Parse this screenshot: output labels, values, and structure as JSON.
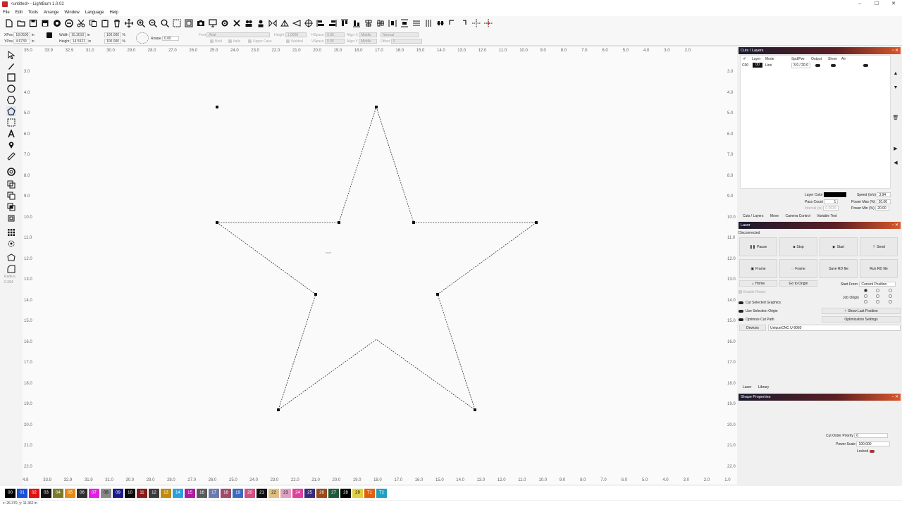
{
  "window": {
    "title": "<untitled> - LightBurn 1.0.02",
    "minimize": "–",
    "maximize": "☐",
    "close": "✕"
  },
  "menu": [
    "File",
    "Edit",
    "Tools",
    "Arrange",
    "Window",
    "Language",
    "Help"
  ],
  "numeric_edits": {
    "xpos_label": "XPos",
    "xpos_value": "18.0500",
    "ypos_label": "YPos",
    "ypos_value": "4.6739",
    "unit": "in",
    "width_label": "Width",
    "width_value": "15.3010",
    "height_label": "Height",
    "height_value": "14.5521",
    "scale_w": "100.000",
    "scale_h": "100.000",
    "percent": "%",
    "rotate_label": "Rotate",
    "rotate_value": "0.00",
    "font_label": "Font",
    "font_value": "Arial",
    "text_height_label": "Height",
    "text_height_value": "1.0000",
    "hspace_label": "HSpace",
    "hspace_value": "0.00",
    "vspace_label": "VSpace",
    "vspace_value": "0.00",
    "align_x_label": "Align X",
    "align_x_value": "Middle",
    "align_y_label": "Align Y",
    "align_y_value": "Middle",
    "normal_value": "Normal",
    "offset_label": "Offset",
    "offset_value": "0",
    "bold": "Bold",
    "italic": "Italic",
    "upper_case": "Upper Case",
    "welded": "Welded"
  },
  "rulers": {
    "top": [
      "35.0",
      "33.9",
      "32.9",
      "31.0",
      "30.0",
      "29.0",
      "28.0",
      "27.0",
      "26.0",
      "25.0",
      "24.0",
      "23.0",
      "22.0",
      "21.0",
      "20.0",
      "19.0",
      "18.0",
      "17.0",
      "16.0",
      "15.0",
      "14.0",
      "13.0",
      "12.0",
      "11.0",
      "10.0",
      "9.0",
      "8.0",
      "7.0",
      "6.0",
      "5.0",
      "4.0",
      "3.0",
      "2.0"
    ],
    "bottom": [
      "4.9",
      "33.9",
      "32.9",
      "31.9",
      "31.0",
      "30.0",
      "29.0",
      "28.0",
      "27.0",
      "26.0",
      "25.0",
      "24.0",
      "23.0",
      "22.0",
      "21.0",
      "20.0",
      "19.0",
      "18.0",
      "17.0",
      "16.0",
      "15.0",
      "14.0",
      "13.0",
      "12.0",
      "11.0",
      "10.0",
      "9.0",
      "8.0",
      "7.0",
      "6.0",
      "5.0",
      "4.0",
      "3.0",
      "2.0",
      "1.0"
    ],
    "left": [
      "3.0",
      "4.0",
      "5.0",
      "6.0",
      "7.0",
      "8.0",
      "9.0",
      "10.0",
      "11.0",
      "12.0",
      "13.0",
      "14.0",
      "15.0",
      "16.0",
      "17.0",
      "18.0",
      "19.0",
      "20.0",
      "21.0",
      "22.0"
    ],
    "right": [
      "3.0",
      "4.0",
      "5.0",
      "6.0",
      "7.0",
      "8.0",
      "9.0",
      "10.0",
      "11.0",
      "12.0",
      "13.0",
      "14.0",
      "15.0",
      "16.0",
      "17.0",
      "18.0",
      "19.0",
      "20.0",
      "21.0",
      "22.0"
    ]
  },
  "radius_label": "Radius",
  "radius_value": "0.394",
  "cuts_layers": {
    "title": "Cuts / Layers",
    "headers": [
      "#",
      "Layer",
      "Mode",
      "Spd/Pwr",
      "Output",
      "Show",
      "Air"
    ],
    "row": {
      "num": "C00",
      "layer": "00",
      "mode": "Line",
      "spdpwr": "3.9 / 20.0"
    },
    "layer_color_label": "Layer Color",
    "speed_label": "Speed (in/s)",
    "speed_value": "3.94",
    "pass_count_label": "Pass Count",
    "pass_count_value": "1",
    "power_max_label": "Power Max (%)",
    "power_max_value": "20.00",
    "interval_label": "Interval (in)",
    "interval_value": "0.0039",
    "power_min_label": "Power Min (%)",
    "power_min_value": "20.00",
    "tabs": [
      "Cuts / Layers",
      "Move",
      "Camera Control",
      "Variable Text"
    ]
  },
  "laser": {
    "title": "Laser",
    "status": "Disconnected",
    "buttons": [
      "Pause",
      "Stop",
      "Start",
      "Send",
      "Frame",
      "Frame",
      "Save RD file",
      "Run RD file"
    ],
    "home": "Home",
    "go_to_origin": "Go to Origin",
    "start_from_label": "Start From:",
    "start_from_value": "Current Position",
    "enable_rotary": "Enable Rotary",
    "job_origin": "Job Origin",
    "cut_selected": "Cut Selected Graphics",
    "use_selection_origin": "Use Selection Origin",
    "optimize_cut_path": "Optimize Cut Path",
    "show_last_position": "Show Last Position",
    "optimization_settings": "Optimization Settings",
    "devices": "Devices",
    "device_value": "UniqueCNC U-9060",
    "tabs": [
      "Laser",
      "Library"
    ]
  },
  "shape_properties": {
    "title": "Shape Properties",
    "cut_order_label": "Cut Order Priority",
    "cut_order_value": "0",
    "power_scale_label": "Power Scale",
    "power_scale_value": "100.000",
    "locked_label": "Locked"
  },
  "palette": [
    {
      "label": "00",
      "color": "#000000"
    },
    {
      "label": "01",
      "color": "#1a4fd6"
    },
    {
      "label": "02",
      "color": "#e01010"
    },
    {
      "label": "03",
      "color": "#111111"
    },
    {
      "label": "04",
      "color": "#7a7a2a"
    },
    {
      "label": "05",
      "color": "#e58a16"
    },
    {
      "label": "06",
      "color": "#2f2f2f"
    },
    {
      "label": "07",
      "color": "#e020e0"
    },
    {
      "label": "08",
      "color": "#888888"
    },
    {
      "label": "09",
      "color": "#1a1a8a"
    },
    {
      "label": "10",
      "color": "#0a0a0a"
    },
    {
      "label": "11",
      "color": "#8a1a1a"
    },
    {
      "label": "12",
      "color": "#3a3a3a"
    },
    {
      "label": "13",
      "color": "#c08a10"
    },
    {
      "label": "14",
      "color": "#2aa0e0"
    },
    {
      "label": "15",
      "color": "#b01aa0"
    },
    {
      "label": "16",
      "color": "#5a5a5a"
    },
    {
      "label": "17",
      "color": "#6a7ab0"
    },
    {
      "label": "18",
      "color": "#a04a6a"
    },
    {
      "label": "19",
      "color": "#3a6ac0"
    },
    {
      "label": "20",
      "color": "#d05080"
    },
    {
      "label": "21",
      "color": "#101010"
    },
    {
      "label": "22",
      "color": "#e0c080"
    },
    {
      "label": "23",
      "color": "#e0a0c0"
    },
    {
      "label": "24",
      "color": "#e040a0"
    },
    {
      "label": "25",
      "color": "#3a2a7a"
    },
    {
      "label": "26",
      "color": "#9a4a1a"
    },
    {
      "label": "27",
      "color": "#1a5a3a"
    },
    {
      "label": "28",
      "color": "#000000"
    },
    {
      "label": "29",
      "color": "#e0d040"
    },
    {
      "label": "T1",
      "color": "#e06010"
    },
    {
      "label": "T2",
      "color": "#20a0c0"
    }
  ],
  "status_bar": "x: 26.370, y: 11.362 in",
  "colors": {
    "accent_gradient_start": "#1a1a2e",
    "accent_gradient_end": "#d9572a",
    "canvas": "#fafafa"
  }
}
